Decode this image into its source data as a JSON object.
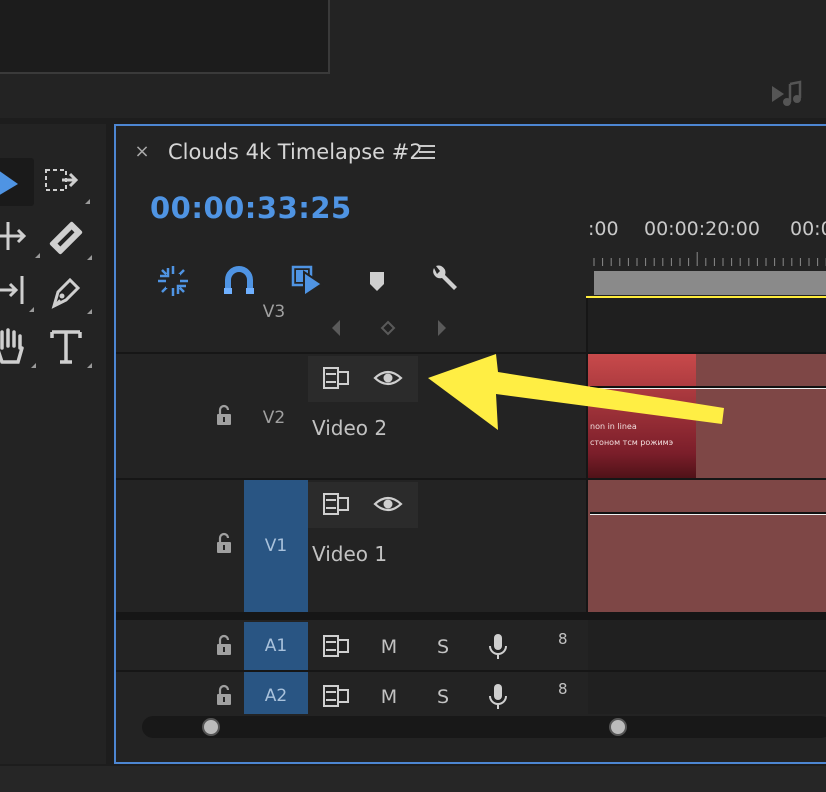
{
  "sequence": {
    "close_label": "×",
    "title": "Clouds 4k Timelapse #2",
    "timecode": "00:00:33:25"
  },
  "ruler": {
    "labels": [
      ":00",
      "00:00:20:00",
      "00:0"
    ]
  },
  "tracks": {
    "v3": {
      "label": "V3"
    },
    "v2": {
      "label": "V2",
      "name": "Video 2"
    },
    "v1": {
      "label": "V1",
      "name": "Video 1"
    },
    "a1": {
      "label": "A1",
      "mute": "M",
      "solo": "S",
      "volume": "8"
    },
    "a2": {
      "label": "A2",
      "mute": "M",
      "solo": "S",
      "volume": "8"
    }
  },
  "clip": {
    "text_line1": "non in linea",
    "text_line2": "стоном тсм рожимэ"
  },
  "colors": {
    "accent": "#4f94e3",
    "target_track": "#295583",
    "annotation_arrow": "#ffee44",
    "clip": "#7e4746",
    "work_area": "#ffec3d"
  },
  "icons": {
    "tools": [
      "selection-tool-icon",
      "track-select-forward-icon",
      "ripple-edit-icon",
      "razor-icon",
      "slip-icon",
      "pen-icon",
      "hand-icon",
      "type-icon"
    ],
    "timeline_tools": [
      "nest-icon",
      "snap-magnet-icon",
      "linked-selection-icon",
      "add-marker-icon",
      "wrench-icon"
    ],
    "annotation": "yellow-arrow-icon"
  },
  "scrollbar": {
    "left_handle_fraction": 0.1,
    "right_handle_fraction": 0.69
  }
}
